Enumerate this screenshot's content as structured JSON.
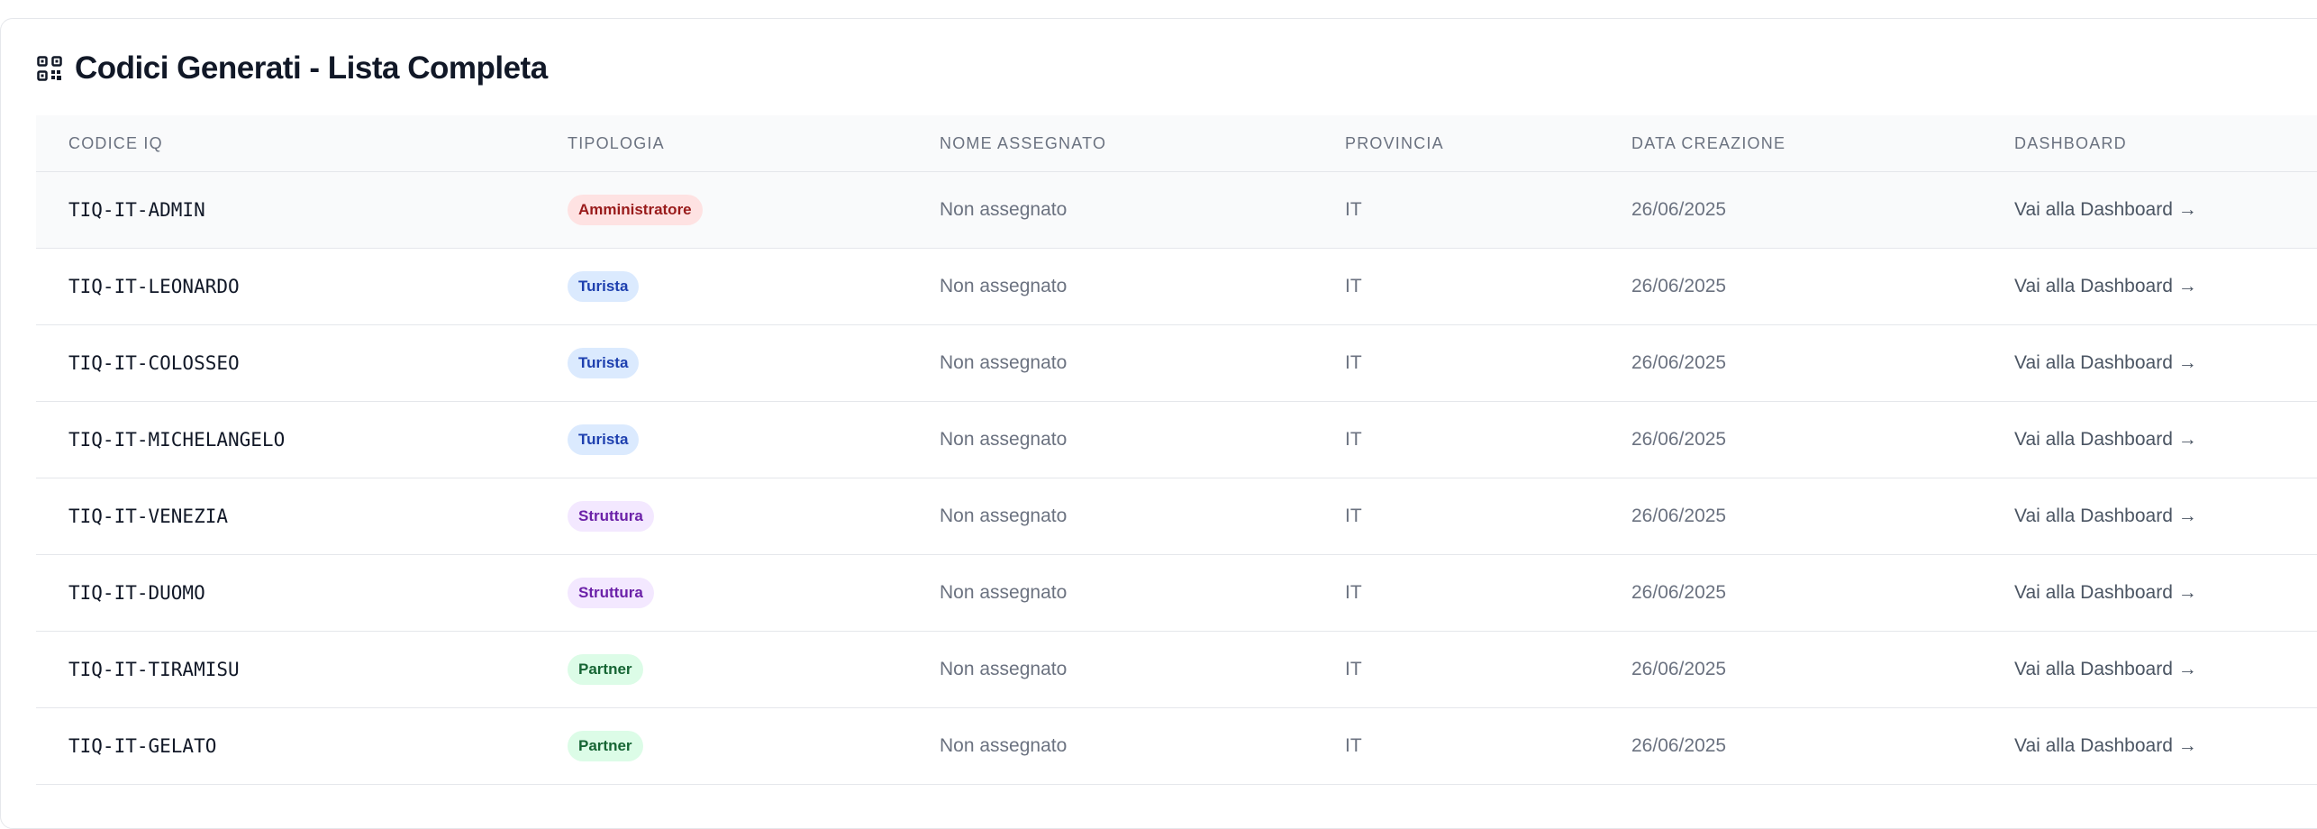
{
  "header": {
    "title": "Codici Generati - Lista Completa",
    "icon": "qr-code-icon"
  },
  "table": {
    "columns": [
      "CODICE IQ",
      "TIPOLOGIA",
      "NOME ASSEGNATO",
      "PROVINCIA",
      "DATA CREAZIONE",
      "DASHBOARD"
    ],
    "rows": [
      {
        "code": "TIQ-IT-ADMIN",
        "type": "Amministratore",
        "type_kind": "admin",
        "name": "Non assegnato",
        "province": "IT",
        "date": "26/06/2025",
        "dashboard": "Vai alla Dashboard →"
      },
      {
        "code": "TIQ-IT-LEONARDO",
        "type": "Turista",
        "type_kind": "turista",
        "name": "Non assegnato",
        "province": "IT",
        "date": "26/06/2025",
        "dashboard": "Vai alla Dashboard →"
      },
      {
        "code": "TIQ-IT-COLOSSEO",
        "type": "Turista",
        "type_kind": "turista",
        "name": "Non assegnato",
        "province": "IT",
        "date": "26/06/2025",
        "dashboard": "Vai alla Dashboard →"
      },
      {
        "code": "TIQ-IT-MICHELANGELO",
        "type": "Turista",
        "type_kind": "turista",
        "name": "Non assegnato",
        "province": "IT",
        "date": "26/06/2025",
        "dashboard": "Vai alla Dashboard →"
      },
      {
        "code": "TIQ-IT-VENEZIA",
        "type": "Struttura",
        "type_kind": "struttura",
        "name": "Non assegnato",
        "province": "IT",
        "date": "26/06/2025",
        "dashboard": "Vai alla Dashboard →"
      },
      {
        "code": "TIQ-IT-DUOMO",
        "type": "Struttura",
        "type_kind": "struttura",
        "name": "Non assegnato",
        "province": "IT",
        "date": "26/06/2025",
        "dashboard": "Vai alla Dashboard →"
      },
      {
        "code": "TIQ-IT-TIRAMISU",
        "type": "Partner",
        "type_kind": "partner",
        "name": "Non assegnato",
        "province": "IT",
        "date": "26/06/2025",
        "dashboard": "Vai alla Dashboard →"
      },
      {
        "code": "TIQ-IT-GELATO",
        "type": "Partner",
        "type_kind": "partner",
        "name": "Non assegnato",
        "province": "IT",
        "date": "26/06/2025",
        "dashboard": "Vai alla Dashboard →"
      }
    ]
  },
  "badge_colors": {
    "admin": {
      "bg": "#fee2e2",
      "fg": "#991b1b"
    },
    "turista": {
      "bg": "#dbeafe",
      "fg": "#1e40af"
    },
    "struttura": {
      "bg": "#f3e8ff",
      "fg": "#6b21a8"
    },
    "partner": {
      "bg": "#dcfce7",
      "fg": "#166534"
    }
  }
}
